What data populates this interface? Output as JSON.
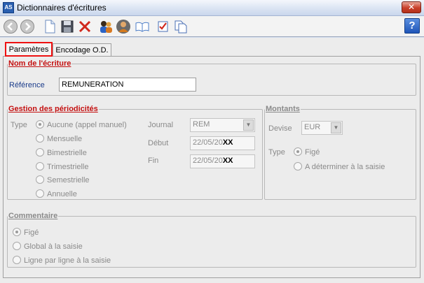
{
  "window": {
    "title": "Dictionnaires d'écritures",
    "app_icon": "AS",
    "close": "✕"
  },
  "toolbar": {
    "help": "?"
  },
  "tabs": [
    {
      "label": "Paramètres"
    },
    {
      "label": "Encodage O.D."
    }
  ],
  "nom": {
    "legend": "Nom de l'écriture",
    "reference_label": "Référence",
    "reference_value": "REMUNERATION"
  },
  "periodicite": {
    "legend": "Gestion des périodicités",
    "type_label": "Type",
    "options": [
      "Aucune (appel manuel)",
      "Mensuelle",
      "Bimestrielle",
      "Trimestrielle",
      "Semestrielle",
      "Annuelle"
    ],
    "journal_label": "Journal",
    "journal_value": "REM",
    "debut_label": "Début",
    "debut_value": "22/05/20",
    "debut_suffix": "XX",
    "fin_label": "Fin",
    "fin_value": "22/05/20",
    "fin_suffix": "XX"
  },
  "montants": {
    "legend": "Montants",
    "devise_label": "Devise",
    "devise_value": "EUR",
    "type_label": "Type",
    "options": [
      "Figé",
      "A déterminer à la saisie"
    ]
  },
  "commentaire": {
    "legend": "Commentaire",
    "options": [
      "Figé",
      "Global à la saisie",
      "Ligne par ligne à la saisie"
    ]
  }
}
